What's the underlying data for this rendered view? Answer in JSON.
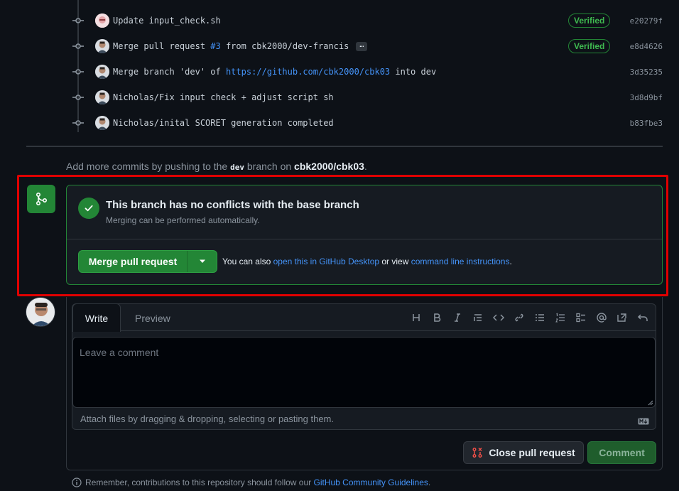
{
  "commits": [
    {
      "avatar": "avatar-pink",
      "message": "Update input_check.sh",
      "verified": "Verified",
      "sha": "e20279f"
    },
    {
      "avatar": "avatar-person",
      "message_prefix": "Merge pull request ",
      "pr_link": "#3",
      "message_suffix": " from cbk2000/dev-francis",
      "ellipsis": "…",
      "verified": "Verified",
      "sha": "e8d4626"
    },
    {
      "avatar": "avatar-person",
      "message_prefix": "Merge branch 'dev' of ",
      "url_link": "https://github.com/cbk2000/cbk03",
      "message_suffix": " into dev",
      "sha": "3d35235"
    },
    {
      "avatar": "avatar-person",
      "message": "Nicholas/Fix input check + adjust script sh",
      "sha": "3d8d9bf"
    },
    {
      "avatar": "avatar-person",
      "message": "Nicholas/inital SCORET generation completed",
      "sha": "b83fbe3"
    }
  ],
  "add_more": {
    "prefix": "Add more commits by pushing to the ",
    "branch": "dev",
    "middle": " branch on ",
    "repo": "cbk2000/cbk03",
    "suffix": "."
  },
  "merge": {
    "title": "This branch has no conflicts with the base branch",
    "subtitle": "Merging can be performed automatically.",
    "button_label": "Merge pull request",
    "alt_prefix": "You can also ",
    "alt_link_desktop": "open this in GitHub Desktop",
    "alt_middle": " or view ",
    "alt_link_cli": "command line instructions",
    "alt_suffix": ".",
    "accent_color": "#238636"
  },
  "comment": {
    "tab_write": "Write",
    "tab_preview": "Preview",
    "placeholder": "Leave a comment",
    "attach_text": "Attach files by dragging & dropping, selecting or pasting them.",
    "close_button": "Close pull request",
    "comment_button": "Comment",
    "toolbar_icons": [
      "heading-icon",
      "bold-icon",
      "italic-icon",
      "quote-icon",
      "code-icon",
      "link-icon",
      "unordered-list-icon",
      "ordered-list-icon",
      "task-list-icon",
      "mention-icon",
      "reference-icon",
      "undo-icon"
    ]
  },
  "footer": {
    "prefix": "Remember, contributions to this repository should follow our ",
    "link": "GitHub Community Guidelines",
    "suffix": "."
  },
  "highlight_color": "#e00000"
}
